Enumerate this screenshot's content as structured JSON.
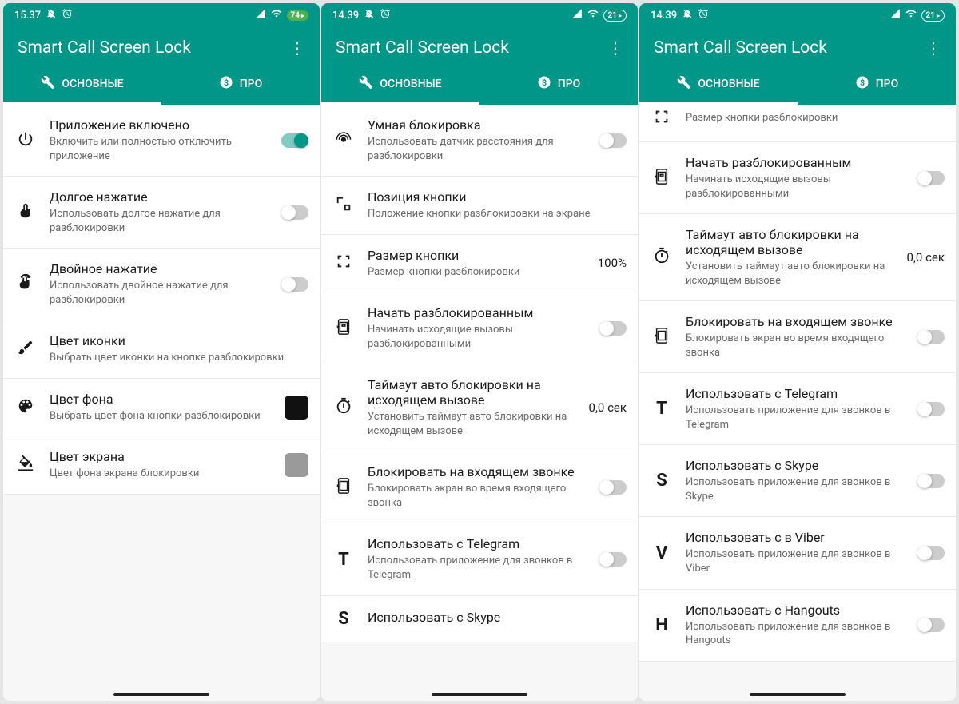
{
  "colors": {
    "primary": "#009688",
    "battery_green": "#4caf50"
  },
  "screens": [
    {
      "status": {
        "time": "15.37",
        "battery": "74",
        "battery_style": "pill"
      },
      "app_title": "Smart Call Screen Lock",
      "tabs": {
        "main": "ОСНОВНЫЕ",
        "pro": "ПРО",
        "active": "main"
      },
      "items": [
        {
          "icon": "power",
          "title": "Приложение включено",
          "sub": "Включить или полностью отключить приложение",
          "trailing": {
            "type": "switch",
            "on": true
          }
        },
        {
          "icon": "tap",
          "title": "Долгое нажатие",
          "sub": "Использовать долгое нажатие для разблокировки",
          "trailing": {
            "type": "switch",
            "on": false
          }
        },
        {
          "icon": "doubletap",
          "title": "Двойное нажатие",
          "sub": "Использовать двойное нажатие для разблокировки",
          "trailing": {
            "type": "switch",
            "on": false
          }
        },
        {
          "icon": "brush",
          "title": "Цвет иконки",
          "sub": "Выбрать цвет иконки на кнопке разблокировки",
          "trailing": {
            "type": "none"
          }
        },
        {
          "icon": "palette",
          "title": "Цвет фона",
          "sub": "Выбрать цвет фона кнопки разблокировки",
          "trailing": {
            "type": "color",
            "value": "#111111"
          }
        },
        {
          "icon": "fill",
          "title": "Цвет экрана",
          "sub": "Цвет фона экрана блокировки",
          "trailing": {
            "type": "color",
            "value": "#9a9a9a"
          }
        }
      ]
    },
    {
      "status": {
        "time": "14.39",
        "battery": "21",
        "battery_style": "outline"
      },
      "app_title": "Smart Call Screen Lock",
      "tabs": {
        "main": "ОСНОВНЫЕ",
        "pro": "ПРО",
        "active": "main"
      },
      "items": [
        {
          "icon": "sensor",
          "title": "Умная блокировка",
          "sub": "Использовать датчик расстояния для разблокировки",
          "trailing": {
            "type": "switch",
            "on": false
          }
        },
        {
          "icon": "position",
          "title": "Позиция кнопки",
          "sub": "Положение кнопки разблокировки на экране",
          "trailing": {
            "type": "none"
          }
        },
        {
          "icon": "expand",
          "title": "Размер кнопки",
          "sub": "Размер кнопки разблокировки",
          "trailing": {
            "type": "text",
            "value": "100%"
          }
        },
        {
          "icon": "unlockphone",
          "title": "Начать разблокированным",
          "sub": "Начинать исходящие вызовы разблокированными",
          "trailing": {
            "type": "switch",
            "on": false
          }
        },
        {
          "icon": "timer",
          "title": "Таймаут авто блокировки на исходящем вызове",
          "sub": "Установить таймаут авто блокировки на исходящем вызове",
          "trailing": {
            "type": "text",
            "value": "0,0 сек"
          }
        },
        {
          "icon": "lockphone",
          "title": "Блокировать на входящем звонке",
          "sub": "Блокировать экран во время входящего звонка",
          "trailing": {
            "type": "switch",
            "on": false
          }
        },
        {
          "icon": "letter",
          "letter": "T",
          "title": "Использовать с Telegram",
          "sub": "Использовать приложение для звонков в Telegram",
          "trailing": {
            "type": "switch",
            "on": false
          }
        },
        {
          "icon": "letter",
          "letter": "S",
          "title": "Использовать с Skype",
          "sub": "",
          "trailing": {
            "type": "none"
          }
        }
      ]
    },
    {
      "status": {
        "time": "14.39",
        "battery": "21",
        "battery_style": "outline"
      },
      "app_title": "Smart Call Screen Lock",
      "tabs": {
        "main": "ОСНОВНЫЕ",
        "pro": "ПРО",
        "active": "main"
      },
      "partial_first": true,
      "items": [
        {
          "icon": "expand",
          "title": "",
          "sub": "Размер кнопки разблокировки",
          "trailing": {
            "type": "none"
          }
        },
        {
          "icon": "unlockphone",
          "title": "Начать разблокированным",
          "sub": "Начинать исходящие вызовы разблокированными",
          "trailing": {
            "type": "switch",
            "on": false
          }
        },
        {
          "icon": "timer",
          "title": "Таймаут авто блокировки на исходящем вызове",
          "sub": "Установить таймаут авто блокировки на исходящем вызове",
          "trailing": {
            "type": "text",
            "value": "0,0 сек"
          }
        },
        {
          "icon": "lockphone",
          "title": "Блокировать на входящем звонке",
          "sub": "Блокировать экран во время входящего звонка",
          "trailing": {
            "type": "switch",
            "on": false
          }
        },
        {
          "icon": "letter",
          "letter": "T",
          "title": "Использовать с Telegram",
          "sub": "Использовать приложение для звонков в Telegram",
          "trailing": {
            "type": "switch",
            "on": false
          }
        },
        {
          "icon": "letter",
          "letter": "S",
          "title": "Использовать с Skype",
          "sub": "Использовать приложение для звонков в Skype",
          "trailing": {
            "type": "switch",
            "on": false
          }
        },
        {
          "icon": "letter",
          "letter": "V",
          "title": "Использовать с в Viber",
          "sub": "Использовать приложение для звонков в Viber",
          "trailing": {
            "type": "switch",
            "on": false
          }
        },
        {
          "icon": "letter",
          "letter": "H",
          "title": "Использовать с Hangouts",
          "sub": "Использовать приложение для звонков в Hangouts",
          "trailing": {
            "type": "switch",
            "on": false
          }
        }
      ]
    }
  ]
}
